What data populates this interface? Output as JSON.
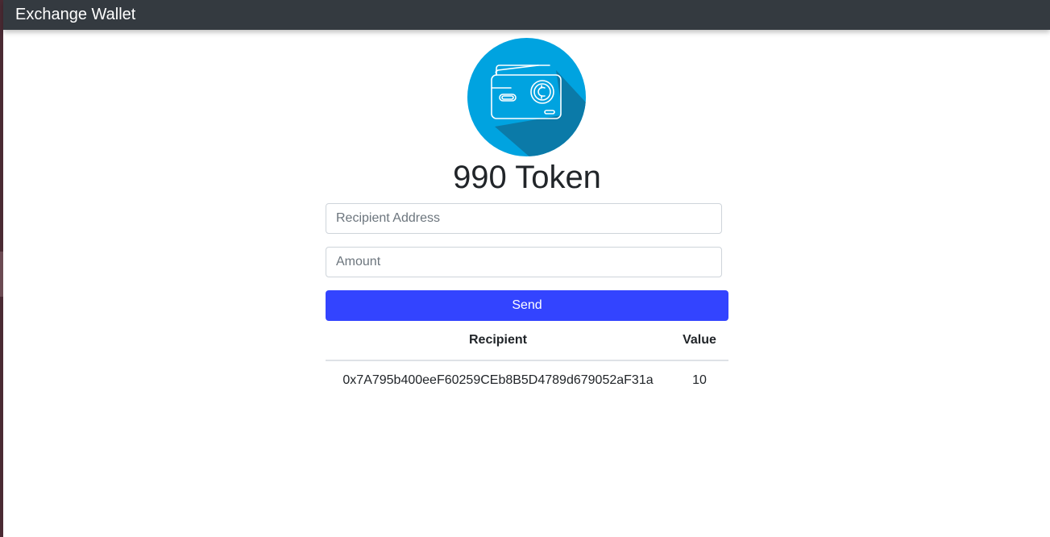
{
  "navbar": {
    "brand": "Exchange Wallet"
  },
  "wallet": {
    "icon": "wallet-coin-icon",
    "balance": "990 Token"
  },
  "form": {
    "recipient_placeholder": "Recipient Address",
    "amount_placeholder": "Amount",
    "send_label": "Send"
  },
  "transactions": {
    "headers": {
      "recipient": "Recipient",
      "value": "Value"
    },
    "rows": [
      {
        "recipient": "0x7A795b400eeF60259CEb8B5D4789d679052aF31a",
        "value": "10"
      }
    ]
  },
  "colors": {
    "navbar": "#343a40",
    "send_button": "#3344ff",
    "logo_circle": "#00a3e0",
    "logo_shadow": "#0b7aa8"
  }
}
